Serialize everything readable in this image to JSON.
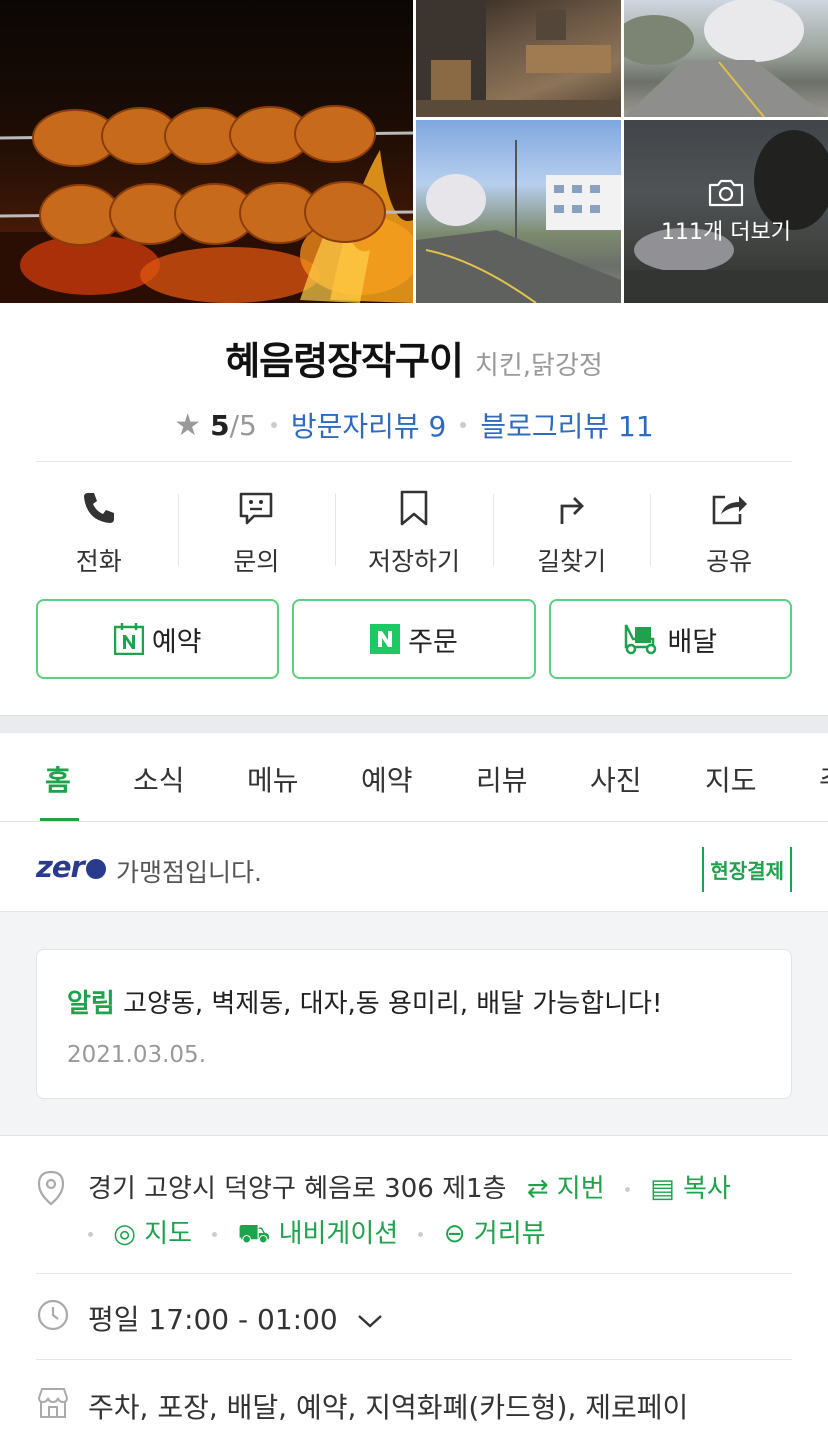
{
  "photos": {
    "more_label": "111개 더보기"
  },
  "place": {
    "name": "혜음령장작구이",
    "category": "치킨,닭강정",
    "rating": "5",
    "rating_max": "/5",
    "visitor_reviews": "방문자리뷰 9",
    "blog_reviews": "블로그리뷰 11"
  },
  "actions": [
    {
      "label": "전화",
      "icon": "phone-icon"
    },
    {
      "label": "문의",
      "icon": "chat-icon"
    },
    {
      "label": "저장하기",
      "icon": "bookmark-icon"
    },
    {
      "label": "길찾기",
      "icon": "directions-icon"
    },
    {
      "label": "공유",
      "icon": "share-icon"
    }
  ],
  "buttons": [
    {
      "label": "예약",
      "icon": "naver-calendar-icon"
    },
    {
      "label": "주문",
      "icon": "naver-n-icon"
    },
    {
      "label": "배달",
      "icon": "delivery-icon"
    }
  ],
  "tabs": [
    "홈",
    "소식",
    "메뉴",
    "예약",
    "리뷰",
    "사진",
    "지도",
    "주"
  ],
  "zeropay": {
    "logo": "zer",
    "text": "가맹점입니다.",
    "badge": "현장결제"
  },
  "notice": {
    "tag": "알림",
    "text": "고양동, 벽제동, 대자,동 용미리, 배달 가능합니다!",
    "date": "2021.03.05."
  },
  "address": {
    "text": "경기 고양시 덕양구 혜음로 306 제1층",
    "lot_number": "지번",
    "copy": "복사",
    "map": "지도",
    "navigation": "내비게이션",
    "streetview": "거리뷰"
  },
  "hours": {
    "text": "평일 17:00 - 01:00"
  },
  "services": {
    "text": "주차, 포장, 배달, 예약, 지역화폐(카드형), 제로페이"
  },
  "colors": {
    "accent_green": "#1ea34c",
    "link_blue": "#2e6bbf",
    "star_red": "#f2484f"
  }
}
